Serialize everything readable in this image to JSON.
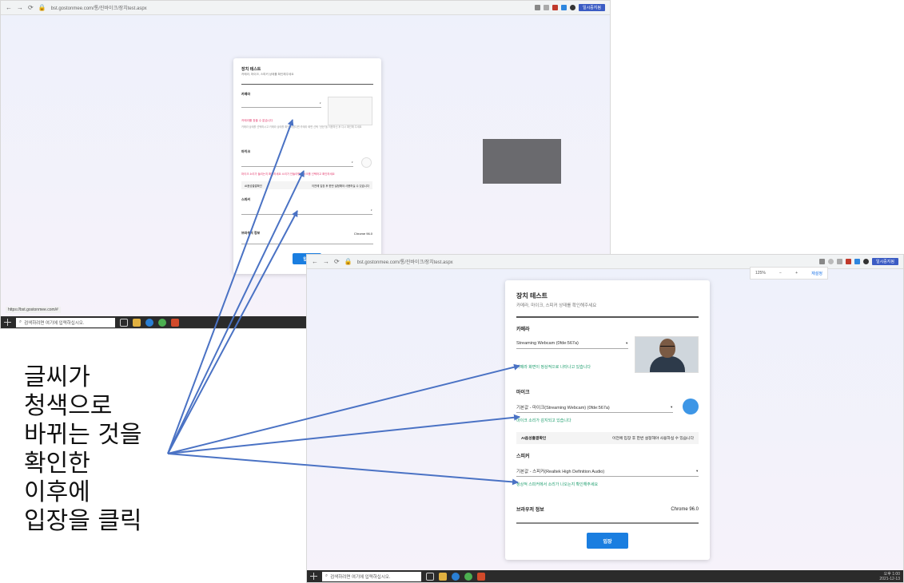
{
  "browser": {
    "url": "bst.gostonmee.com/통/진바이크/장치test.aspx",
    "profile_label": "일시중지됨",
    "zoom_label": "125%",
    "zoom_reset": "재설정",
    "status_tip": "https://bst.gostonmee.com/#"
  },
  "taskbar": {
    "search_placeholder": "검색하려면 여기에 입력하십시오.",
    "clock_time": "오후 1:00",
    "clock_date": "2021-12-13"
  },
  "dialog": {
    "title": "장치 테스트",
    "subtitle": "카메라, 마이크, 스피커 상태를 확인해주세요",
    "camera_section": "카메라",
    "mic_section": "마이크",
    "speaker_section": "스피커",
    "browser_label": "브라우저 정보",
    "browser_value": "Chrome 96.0",
    "enter_label": "입장",
    "ai_label": "AI음성출결확인",
    "ai_hint": "이전에 입장 후 한번 설정해야 사용하실 수 있습니다"
  },
  "back_state": {
    "camera_value": "",
    "camera_msg": "카메라를 찾을 수 없습니다",
    "camera_help": "카메라 상태를 선택하시고 카메라 상태를 확인 하셨다면 카메라 화면 선택 \"권한\"을 허용하신 후 다시 확인해 주세요",
    "mic_value": "",
    "mic_msg": "마이크 소리가 들리는지 확인하세요 소리가 안들리면 마이크를 선택하고 확인하세요",
    "speaker_value": ""
  },
  "front_state": {
    "camera_value": "Streaming Webcam (0fde:567a)",
    "camera_msg": "카메라 화면이 정상적으로 나타나고 있습니다",
    "mic_value": "기본값 - 마이크(Streaming Webcam) (0fde:567a)",
    "mic_msg": "마이크 소리가 감지되고 있습니다",
    "speaker_value": "기본값 - 스피커(Realtek High Definition Audio)",
    "speaker_msg": "정상적 스피커에서 소리가 나오는지 확인해주세요"
  },
  "annotation": {
    "line1": "글씨가",
    "line2": "청색으로",
    "line3": "바뀌는 것을",
    "line4": "확인한",
    "line5": "이후에",
    "line6": "입장을 클릭"
  },
  "colors": {
    "arrow": "#4a72c4",
    "error": "#e43b6d",
    "ok": "#1e9e6e",
    "button": "#1a7ee0"
  }
}
